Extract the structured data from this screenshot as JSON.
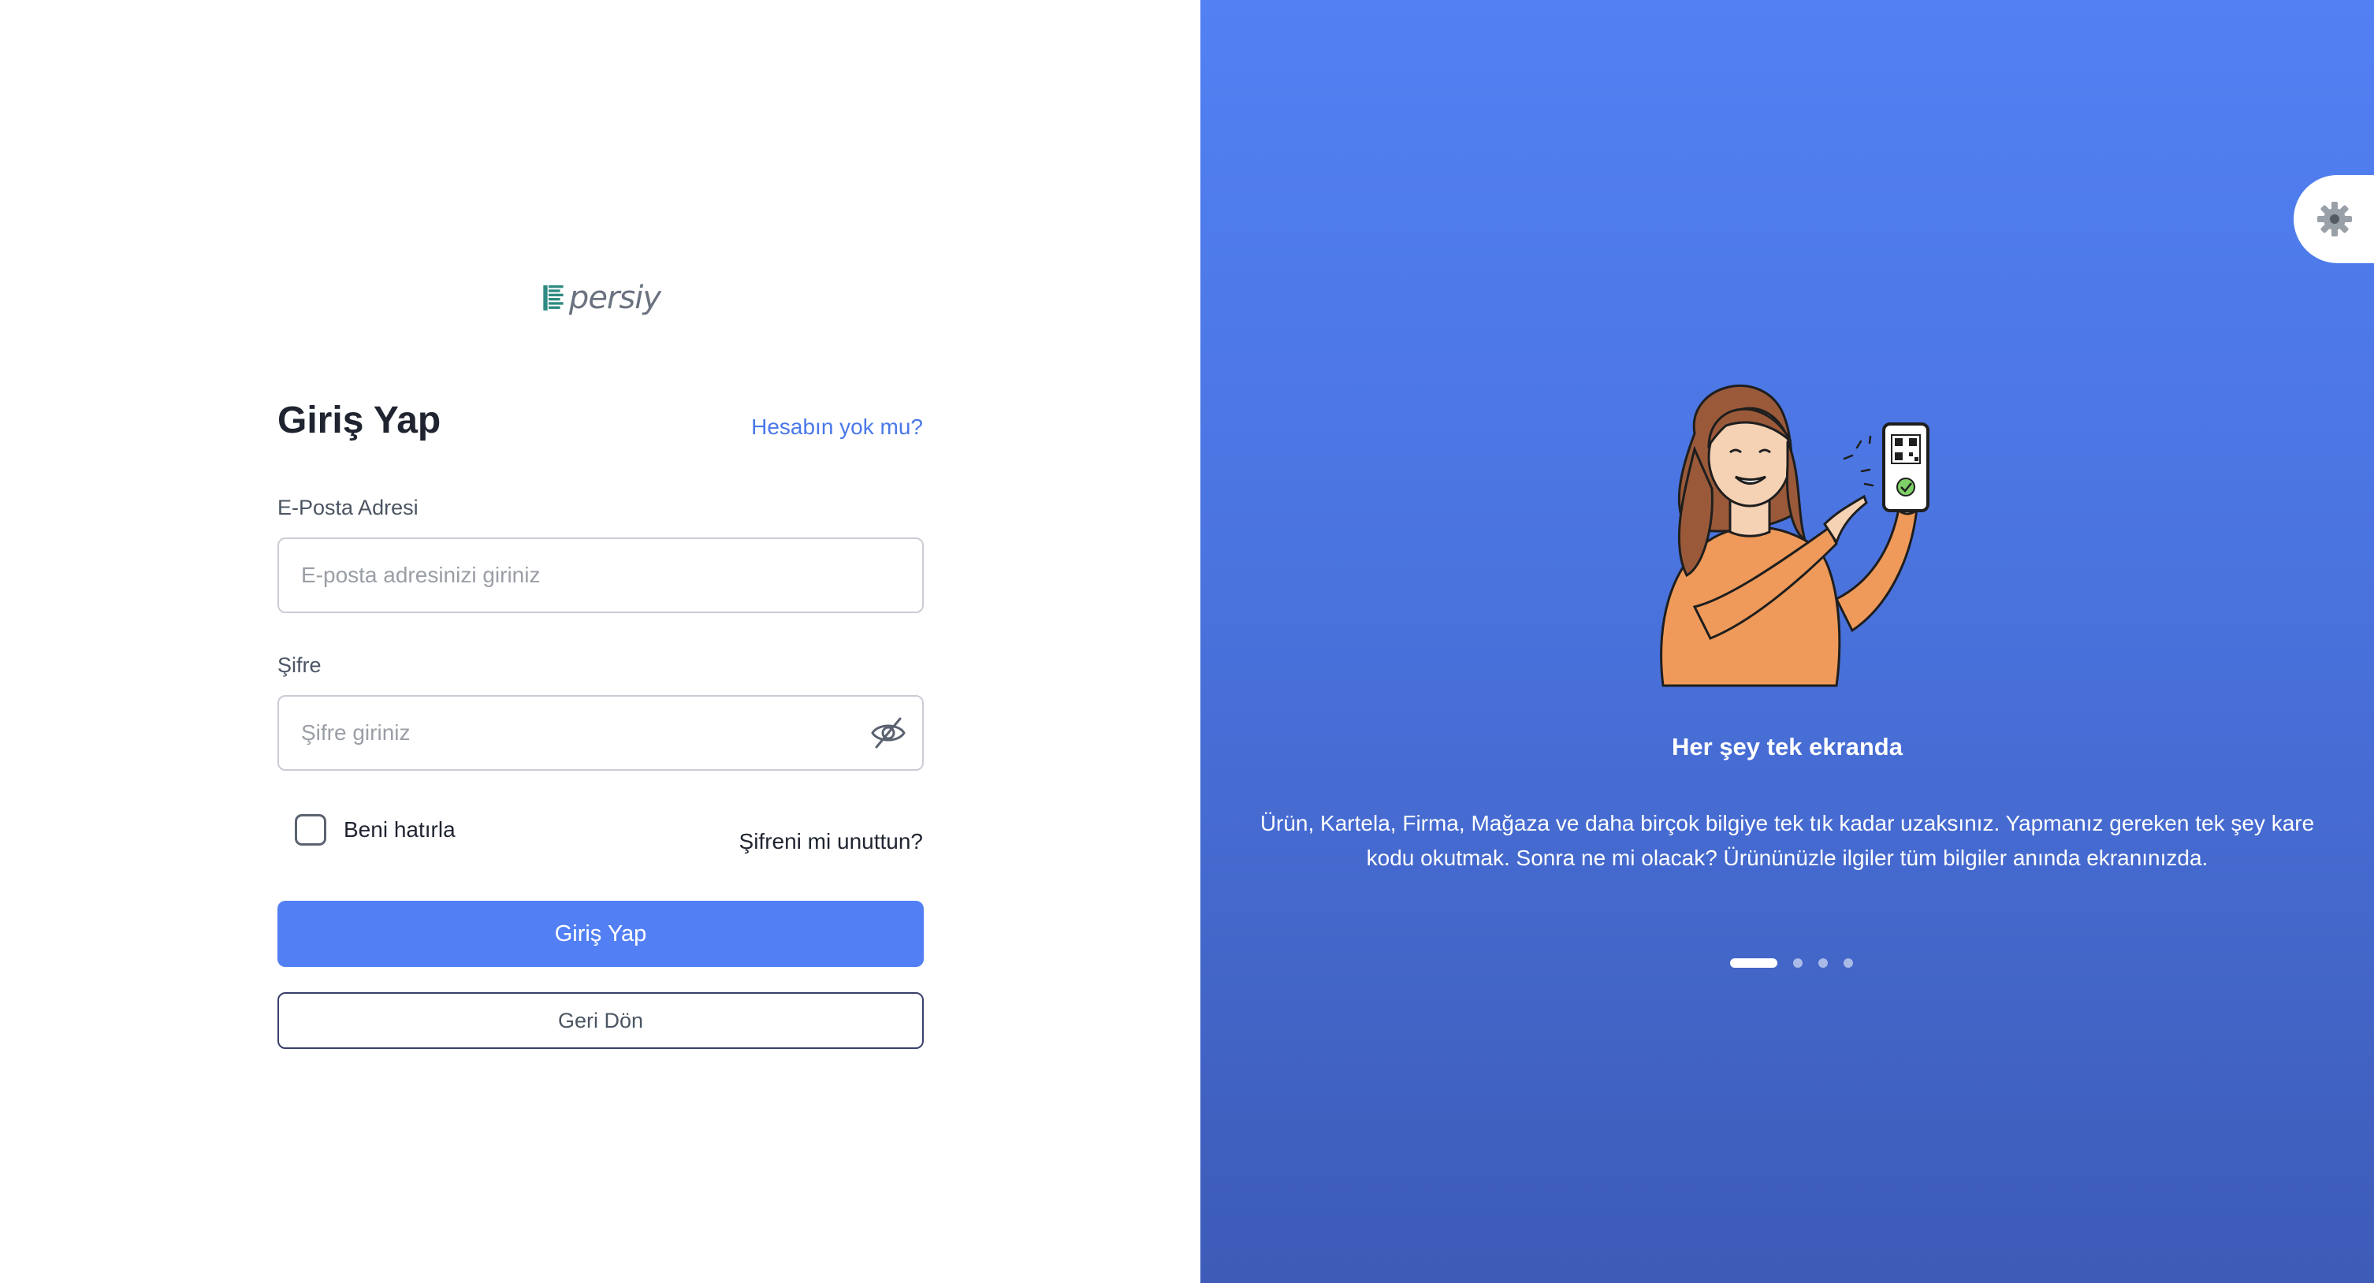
{
  "brand": {
    "name": "persiy"
  },
  "login": {
    "title": "Giriş Yap",
    "signup_link": "Hesabın yok mu?",
    "email_label": "E-Posta Adresi",
    "email_placeholder": "E-posta adresinizi giriniz",
    "email_value": "",
    "password_label": "Şifre",
    "password_placeholder": "Şifre giriniz",
    "password_value": "",
    "password_toggle_icon": "eye-off-icon",
    "remember_label": "Beni hatırla",
    "remember_checked": false,
    "forgot_link": "Şifreni mi unuttun?",
    "submit_label": "Giriş Yap",
    "back_label": "Geri Dön"
  },
  "colors": {
    "accent": "#5280f4",
    "panel_gradient_top": "#5281f4",
    "panel_gradient_bottom": "#3d5bb7",
    "link": "#4a78e8"
  },
  "settings": {
    "icon": "gear-icon"
  },
  "carousel": {
    "active_index": 0,
    "slide_count": 4,
    "illustration": "woman-pointing-at-phone-qr-code-illustration",
    "slide_title": "Her şey tek ekranda",
    "slide_text": "Ürün, Kartela, Firma, Mağaza ve daha birçok bilgiye tek tık kadar uzaksınız. Yapmanız gereken tek şey kare kodu okutmak. Sonra ne mi olacak? Ürününüzle ilgiler tüm bilgiler anında ekranınızda."
  }
}
